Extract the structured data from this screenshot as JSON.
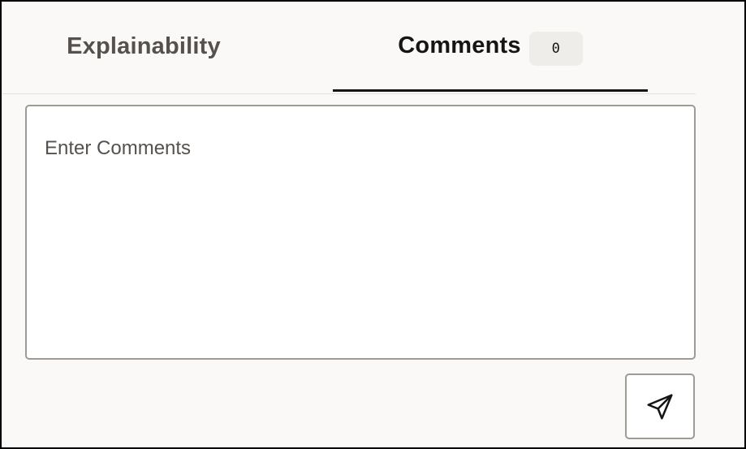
{
  "tabs": {
    "explainability": {
      "label": "Explainability"
    },
    "comments": {
      "label": "Comments",
      "count": "0",
      "selected": true
    }
  },
  "comments_input": {
    "value": "",
    "placeholder": "Enter Comments"
  },
  "send_button": {
    "icon": "send-paper-plane-icon"
  },
  "colors": {
    "active_tab_underline": "#161513",
    "panel_background": "#faf9f8",
    "border": "#9e9a95",
    "badge_background": "#efedea"
  }
}
